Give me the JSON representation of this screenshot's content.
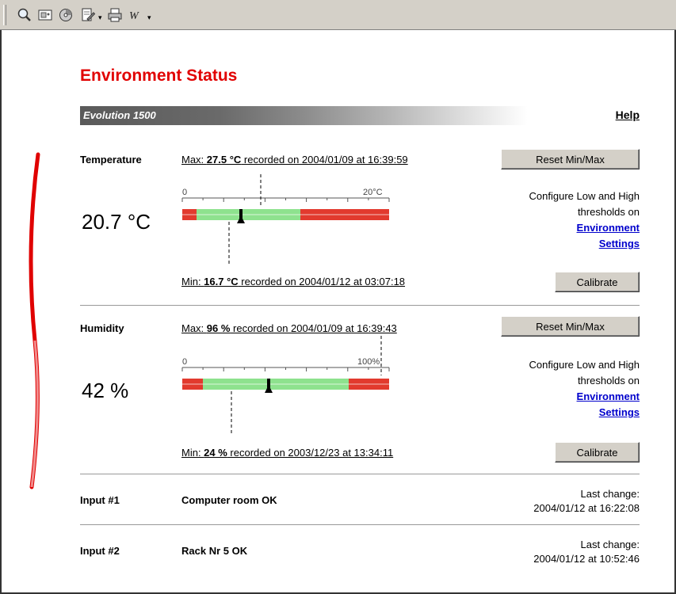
{
  "page": {
    "title": "Environment Status",
    "device_name": "Evolution 1500",
    "help_label": "Help"
  },
  "toolbar": {
    "icons": [
      "magnifier-icon",
      "image-icon",
      "disc-icon",
      "edit-page-icon",
      "print-icon",
      "word-icon"
    ]
  },
  "temperature": {
    "label": "Temperature",
    "value": "20.7 °C",
    "max_prefix": "Max: ",
    "max_value": "27.5 °C",
    "max_suffix": " recorded on 2004/01/09 at 16:39:59",
    "min_prefix": "Min: ",
    "min_value": "16.7 °C",
    "min_suffix": " recorded on 2004/01/12 at 03:07:18",
    "scale_min_label": "0",
    "scale_max_label": "20°C",
    "current": 20.7,
    "scale_end": 20,
    "reset_label": "Reset Min/Max",
    "calibrate_label": "Calibrate",
    "configure_text": "Configure Low and High thresholds on",
    "link1": "Environment",
    "link2": "Settings"
  },
  "humidity": {
    "label": "Humidity",
    "value": "42 %",
    "max_prefix": "Max: ",
    "max_value": "96 %",
    "max_suffix": " recorded on 2004/01/09 at 16:39:43",
    "min_prefix": "Min: ",
    "min_value": "24 %",
    "min_suffix": " recorded on 2003/12/23 at 13:34:11",
    "scale_min_label": "0",
    "scale_max_label": "100%",
    "current": 42,
    "scale_end": 100,
    "reset_label": "Reset Min/Max",
    "calibrate_label": "Calibrate",
    "configure_text": "Configure Low and High thresholds on",
    "link1": "Environment",
    "link2": "Settings"
  },
  "inputs": [
    {
      "label": "Input #1",
      "status": "Computer room OK",
      "last_change_label": "Last change:",
      "last_change": "2004/01/12 at 16:22:08"
    },
    {
      "label": "Input #2",
      "status": "Rack Nr 5 OK",
      "last_change_label": "Last change:",
      "last_change": "2004/01/12 at 10:52:46"
    }
  ],
  "colors": {
    "title": "#e10000",
    "gauge_red": "#e23a2e",
    "gauge_green": "#8ee28e",
    "link": "#0000cc"
  }
}
